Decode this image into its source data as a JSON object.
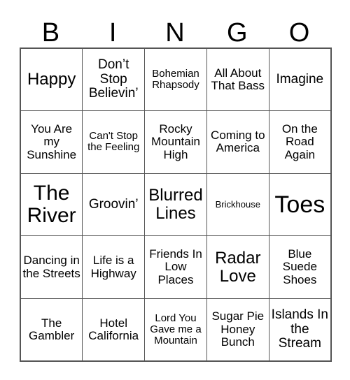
{
  "card": {
    "header": {
      "letters": [
        "B",
        "I",
        "N",
        "G",
        "O"
      ]
    },
    "columns": 5,
    "rows": 5,
    "colors": {
      "background": "#ffffff",
      "text": "#000000",
      "grid_line": "#555555"
    },
    "cells": [
      [
        {
          "text": "Happy",
          "size": "xl"
        },
        {
          "text": "Don’t Stop Believin’",
          "size": "lg"
        },
        {
          "text": "Bohemian Rhapsody",
          "size": "sm"
        },
        {
          "text": "All About That Bass",
          "size": "md"
        },
        {
          "text": "Imagine",
          "size": "lg"
        }
      ],
      [
        {
          "text": "You Are my Sunshine",
          "size": "md"
        },
        {
          "text": "Can't Stop the Feeling",
          "size": "sm"
        },
        {
          "text": "Rocky Mountain High",
          "size": "md"
        },
        {
          "text": "Coming to America",
          "size": "md"
        },
        {
          "text": "On the Road Again",
          "size": "md"
        }
      ],
      [
        {
          "text": "The River",
          "size": "xxl"
        },
        {
          "text": "Groovin’",
          "size": "lg"
        },
        {
          "text": "Blurred Lines",
          "size": "xl"
        },
        {
          "text": "Brickhouse",
          "size": "xs"
        },
        {
          "text": "Toes",
          "size": "huge"
        }
      ],
      [
        {
          "text": "Dancing in the Streets",
          "size": "md"
        },
        {
          "text": "Life is a Highway",
          "size": "md"
        },
        {
          "text": "Friends In Low Places",
          "size": "md"
        },
        {
          "text": "Radar Love",
          "size": "xl"
        },
        {
          "text": "Blue Suede Shoes",
          "size": "md"
        }
      ],
      [
        {
          "text": "The Gambler",
          "size": "md"
        },
        {
          "text": "Hotel California",
          "size": "md"
        },
        {
          "text": "Lord You Gave me a Mountain",
          "size": "sm"
        },
        {
          "text": "Sugar Pie Honey Bunch",
          "size": "md"
        },
        {
          "text": "Islands In the Stream",
          "size": "lg"
        }
      ]
    ]
  }
}
